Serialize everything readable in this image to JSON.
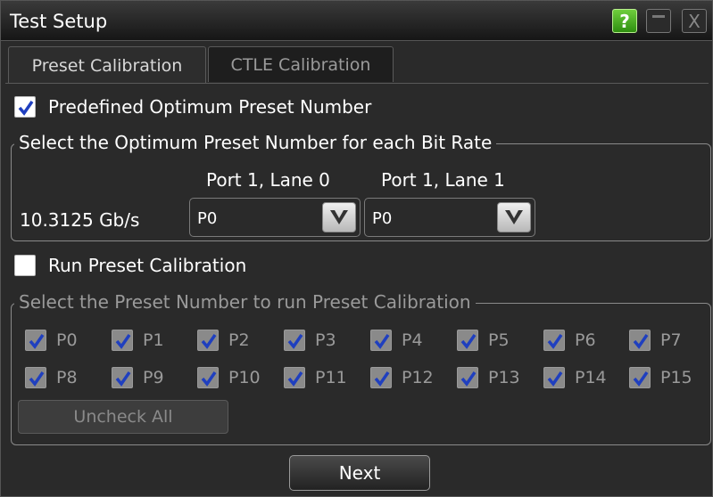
{
  "window": {
    "title": "Test Setup",
    "help_label": "?",
    "close_label": "X"
  },
  "tabs": [
    {
      "label": "Preset Calibration",
      "active": true
    },
    {
      "label": "CTLE Calibration",
      "active": false
    }
  ],
  "predefined": {
    "label": "Predefined Optimum Preset Number",
    "checked": true
  },
  "optimum_group": {
    "legend": "Select the Optimum Preset Number for each Bit Rate",
    "columns": [
      "Port 1, Lane 0",
      "Port 1, Lane 1"
    ],
    "row_label": "10.3125 Gb/s",
    "values": [
      "P0",
      "P0"
    ]
  },
  "run_preset": {
    "label": "Run Preset Calibration",
    "checked": false
  },
  "preset_group": {
    "legend": "Select the Preset Number to run Preset Calibration",
    "presets": [
      "P0",
      "P1",
      "P2",
      "P3",
      "P4",
      "P5",
      "P6",
      "P7",
      "P8",
      "P9",
      "P10",
      "P11",
      "P12",
      "P13",
      "P14",
      "P15"
    ],
    "uncheck_all_label": "Uncheck All"
  },
  "footer": {
    "next_label": "Next"
  },
  "colors": {
    "check_blue": "#1f3fbf",
    "help_green": "#4fb02a"
  }
}
